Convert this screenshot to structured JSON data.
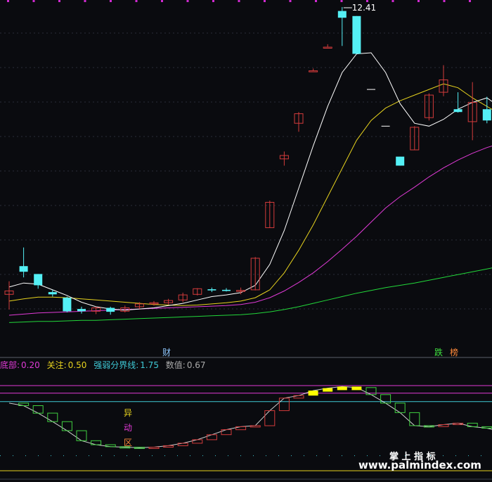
{
  "colors": {
    "background": "#0a0b0f",
    "up": "#d23b3b",
    "down": "#54f0f5",
    "ma5": "#ffffff",
    "ma10": "#e6d21e",
    "ma20": "#e03ad6",
    "ma60": "#22d83a",
    "osc_up": "#d23b3b",
    "osc_down": "#40d040",
    "osc_hot": "#ffff00",
    "line_top": "#e03ad6",
    "line_mid": "#3fc9d6",
    "line_bottom": "#e6d21e"
  },
  "price_chart": {
    "high_label": "12.41",
    "event_tag_left": "财",
    "event_tag_right_1": "跌",
    "event_tag_right_2": "榜"
  },
  "indicator": {
    "bottom_label": "底部:",
    "bottom_value": "0.20",
    "focus_label": "关注:",
    "focus_value": "0.50",
    "divider_label": "强弱分界线:",
    "divider_value": "1.75",
    "value_label": "数值:",
    "value_value": "0.67",
    "zone_chars": [
      "异",
      "动",
      "区"
    ]
  },
  "watermark": {
    "title": "掌 上 指 标",
    "url": "www.palmindex.com"
  },
  "chart_data": [
    {
      "type": "candlestick",
      "title": "",
      "y_scale_note": "price",
      "high_marker": 12.41,
      "candles": [
        {
          "o": 7.32,
          "h": 7.55,
          "l": 7.05,
          "c": 7.38
        },
        {
          "o": 7.82,
          "h": 8.15,
          "l": 7.62,
          "c": 7.72
        },
        {
          "o": 7.68,
          "h": 7.68,
          "l": 7.42,
          "c": 7.48
        },
        {
          "o": 7.36,
          "h": 7.4,
          "l": 7.28,
          "c": 7.32
        },
        {
          "o": 7.26,
          "h": 7.28,
          "l": 7.0,
          "c": 7.02
        },
        {
          "o": 7.06,
          "h": 7.1,
          "l": 6.98,
          "c": 7.02
        },
        {
          "o": 7.02,
          "h": 7.1,
          "l": 6.97,
          "c": 7.08
        },
        {
          "o": 7.08,
          "h": 7.1,
          "l": 6.96,
          "c": 7.01
        },
        {
          "o": 7.02,
          "h": 7.12,
          "l": 7.0,
          "c": 7.08
        },
        {
          "o": 7.1,
          "h": 7.18,
          "l": 7.06,
          "c": 7.15
        },
        {
          "o": 7.15,
          "h": 7.2,
          "l": 7.12,
          "c": 7.17
        },
        {
          "o": 7.17,
          "h": 7.24,
          "l": 7.14,
          "c": 7.21
        },
        {
          "o": 7.22,
          "h": 7.35,
          "l": 7.18,
          "c": 7.31
        },
        {
          "o": 7.32,
          "h": 7.43,
          "l": 7.3,
          "c": 7.42
        },
        {
          "o": 7.41,
          "h": 7.44,
          "l": 7.36,
          "c": 7.39
        },
        {
          "o": 7.4,
          "h": 7.43,
          "l": 7.37,
          "c": 7.38
        },
        {
          "o": 7.38,
          "h": 7.44,
          "l": 7.32,
          "c": 7.39
        },
        {
          "o": 7.4,
          "h": 7.98,
          "l": 7.39,
          "c": 7.96
        },
        {
          "o": 8.5,
          "h": 8.98,
          "l": 8.5,
          "c": 8.95
        },
        {
          "o": 9.72,
          "h": 9.85,
          "l": 9.6,
          "c": 9.78
        },
        {
          "o": 10.35,
          "h": 10.55,
          "l": 10.2,
          "c": 10.52
        },
        {
          "o": 11.28,
          "h": 11.32,
          "l": 11.28,
          "c": 11.28
        },
        {
          "o": 11.7,
          "h": 11.75,
          "l": 11.7,
          "c": 11.7
        },
        {
          "o": 12.34,
          "h": 12.41,
          "l": 11.72,
          "c": 12.22
        },
        {
          "o": 12.25,
          "h": 12.25,
          "l": 11.58,
          "c": 11.58
        },
        {
          "o": 10.95,
          "h": 10.95,
          "l": 10.95,
          "c": 10.95
        },
        {
          "o": 10.3,
          "h": 10.3,
          "l": 10.3,
          "c": 10.3
        },
        {
          "o": 9.76,
          "h": 9.76,
          "l": 9.6,
          "c": 9.6
        },
        {
          "o": 9.88,
          "h": 10.3,
          "l": 9.88,
          "c": 10.28
        },
        {
          "o": 10.45,
          "h": 10.88,
          "l": 10.4,
          "c": 10.85
        },
        {
          "o": 10.9,
          "h": 11.38,
          "l": 10.83,
          "c": 11.12
        },
        {
          "o": 10.6,
          "h": 10.9,
          "l": 10.54,
          "c": 10.55
        },
        {
          "o": 10.38,
          "h": 11.08,
          "l": 10.05,
          "c": 10.72
        },
        {
          "o": 10.6,
          "h": 10.82,
          "l": 10.35,
          "c": 10.4
        },
        {
          "o": 10.4,
          "h": 10.55,
          "l": 10.16,
          "c": 10.25
        }
      ],
      "ma5": [
        7.45,
        7.52,
        7.5,
        7.4,
        7.3,
        7.18,
        7.1,
        7.06,
        7.04,
        7.06,
        7.08,
        7.12,
        7.16,
        7.22,
        7.28,
        7.31,
        7.35,
        7.48,
        7.85,
        8.45,
        9.2,
        9.95,
        10.65,
        11.25,
        11.58,
        11.6,
        11.25,
        10.7,
        10.35,
        10.3,
        10.42,
        10.6,
        10.72,
        10.8,
        10.62
      ],
      "ma10": [
        7.2,
        7.24,
        7.27,
        7.27,
        7.26,
        7.24,
        7.22,
        7.2,
        7.18,
        7.16,
        7.14,
        7.13,
        7.12,
        7.13,
        7.15,
        7.17,
        7.2,
        7.26,
        7.4,
        7.7,
        8.1,
        8.55,
        9.05,
        9.55,
        10.05,
        10.4,
        10.62,
        10.75,
        10.85,
        10.95,
        11.05,
        10.98,
        10.8,
        10.65,
        10.5
      ],
      "ma20": [
        6.95,
        6.97,
        6.99,
        7.0,
        7.01,
        7.02,
        7.03,
        7.04,
        7.05,
        7.06,
        7.07,
        7.08,
        7.09,
        7.1,
        7.11,
        7.12,
        7.14,
        7.18,
        7.26,
        7.38,
        7.53,
        7.7,
        7.9,
        8.12,
        8.35,
        8.6,
        8.85,
        9.05,
        9.22,
        9.4,
        9.56,
        9.7,
        9.82,
        9.92,
        10.0
      ],
      "ma60": [
        6.82,
        6.83,
        6.84,
        6.84,
        6.85,
        6.86,
        6.86,
        6.87,
        6.88,
        6.89,
        6.9,
        6.91,
        6.92,
        6.93,
        6.94,
        6.95,
        6.96,
        6.98,
        7.01,
        7.05,
        7.1,
        7.16,
        7.22,
        7.28,
        7.34,
        7.39,
        7.44,
        7.48,
        7.52,
        7.57,
        7.62,
        7.67,
        7.72,
        7.77,
        7.82
      ]
    },
    {
      "type": "step-bar",
      "title": "",
      "ylim": [
        0.2,
        1.9
      ],
      "reference_lines": [
        0.2,
        0.5,
        1.75
      ],
      "levels": [
        1.55,
        1.5,
        1.35,
        1.18,
        1.0,
        0.8,
        0.72,
        0.68,
        0.67,
        0.66,
        0.67,
        0.7,
        0.75,
        0.82,
        0.92,
        1.02,
        1.08,
        1.1,
        1.4,
        1.65,
        1.7,
        1.8,
        1.85,
        1.88,
        1.86,
        1.72,
        1.55,
        1.36,
        1.1,
        1.08,
        1.12,
        1.15,
        1.08,
        1.05,
        0.98
      ]
    }
  ]
}
